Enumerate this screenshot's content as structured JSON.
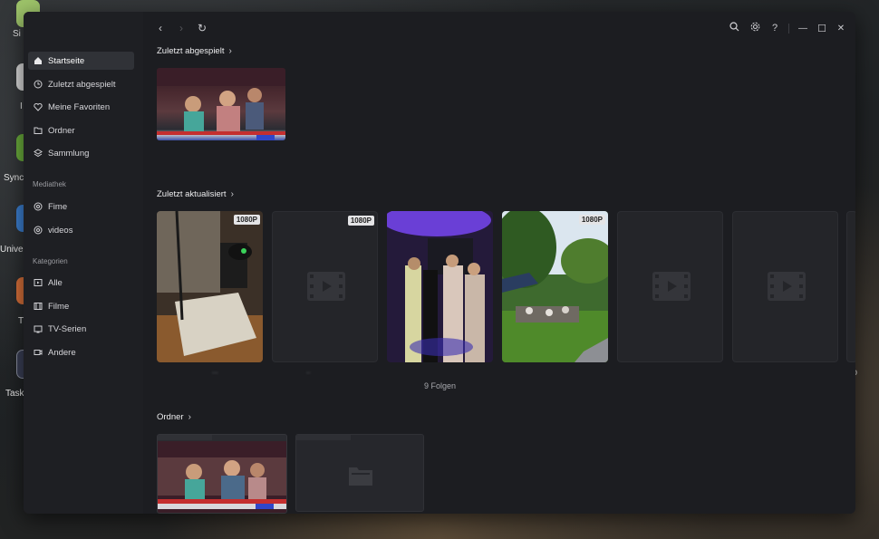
{
  "desktop": {
    "labels": [
      "Si",
      "I",
      "Sync",
      "Univer",
      "T",
      "Task"
    ],
    "right_label": "ho"
  },
  "topbar": {
    "back_label": "‹",
    "forward_label": "›",
    "refresh_label": "↻",
    "search_icon": "search-icon",
    "settings_icon": "gear-icon",
    "help_label": "?",
    "minimize_label": "—",
    "maximize_label": "☐",
    "close_label": "✕"
  },
  "sidebar": {
    "main_items": [
      {
        "label": "Startseite",
        "icon": "home-icon",
        "active": true
      },
      {
        "label": "Zuletzt abgespielt",
        "icon": "clock-icon"
      },
      {
        "label": "Meine Favoriten",
        "icon": "heart-icon"
      },
      {
        "label": "Ordner",
        "icon": "folder-icon"
      },
      {
        "label": "Sammlung",
        "icon": "layers-icon"
      }
    ],
    "library_heading": "Mediathek",
    "library_items": [
      {
        "label": "Fime",
        "icon": "disc-icon"
      },
      {
        "label": "videos",
        "icon": "disc-icon"
      }
    ],
    "categories_heading": "Kategorien",
    "category_items": [
      {
        "label": "Alle",
        "icon": "play-box-icon"
      },
      {
        "label": "Filme",
        "icon": "film-icon"
      },
      {
        "label": "TV-Serien",
        "icon": "tv-icon"
      },
      {
        "label": "Andere",
        "icon": "camera-icon"
      }
    ]
  },
  "sections": {
    "recent_played": {
      "title": "Zuletzt abgespielt"
    },
    "recent_updated": {
      "title": "Zuletzt aktualisiert",
      "cards": [
        {
          "badge": "1080P",
          "caption": "...",
          "kind": "photo-room"
        },
        {
          "badge": "1080P",
          "caption": "..",
          "kind": "empty"
        },
        {
          "badge": "",
          "caption": "",
          "kind": "photo-party"
        },
        {
          "badge": "1080P",
          "caption": "",
          "kind": "photo-garden"
        },
        {
          "badge": "",
          "caption": "",
          "kind": "empty"
        },
        {
          "badge": "",
          "caption": "",
          "kind": "empty"
        }
      ],
      "count_text": "9 Folgen"
    },
    "folders": {
      "title": "Ordner"
    }
  },
  "colors": {
    "window_bg": "#1c1d21",
    "sidebar_bg": "#1e1f23",
    "active_item_bg": "#303237",
    "card_bg": "#242529",
    "badge_bg": "#e4e4e6"
  }
}
